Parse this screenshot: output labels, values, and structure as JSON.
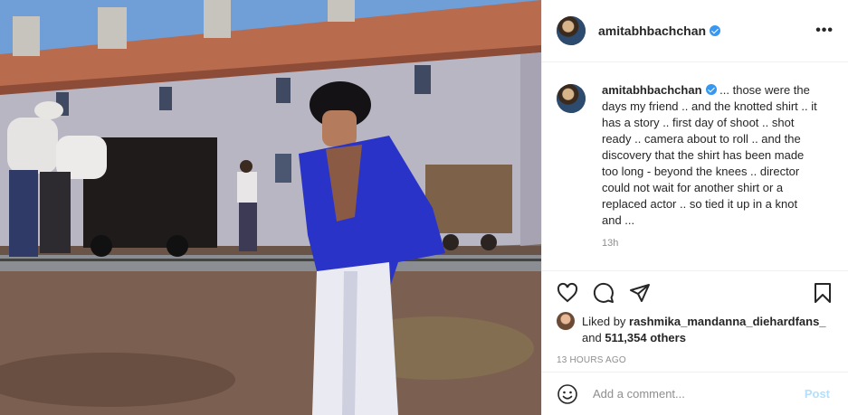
{
  "post": {
    "username": "amitabhbachchan",
    "more_label": "•••",
    "caption": "... those were the days my friend .. and the knotted shirt .. it has a story .. first day of shoot .. shot ready .. camera about to roll .. and the discovery that the shirt has been made too long - beyond the knees .. director could not wait for another shirt or a replaced actor .. so tied it up in a knot and ...",
    "caption_age": "13h",
    "liked_by_prefix": "Liked by",
    "liked_by_user": "rashmika_mandanna_diehardfans_",
    "liked_by_and": "and",
    "liked_by_count": "511,354 others",
    "timestamp": "13 HOURS AGO"
  },
  "comment": {
    "placeholder": "Add a comment...",
    "post_label": "Post"
  },
  "icons": {
    "like": "heart-icon",
    "comment": "comment-bubble-icon",
    "share": "paper-plane-icon",
    "save": "bookmark-icon",
    "emoji": "smiley-icon",
    "verified": "verified-badge-icon"
  },
  "colors": {
    "verified": "#3897f0",
    "post_button_disabled": "#b2dffc",
    "secondary_text": "#8e8e8e"
  }
}
